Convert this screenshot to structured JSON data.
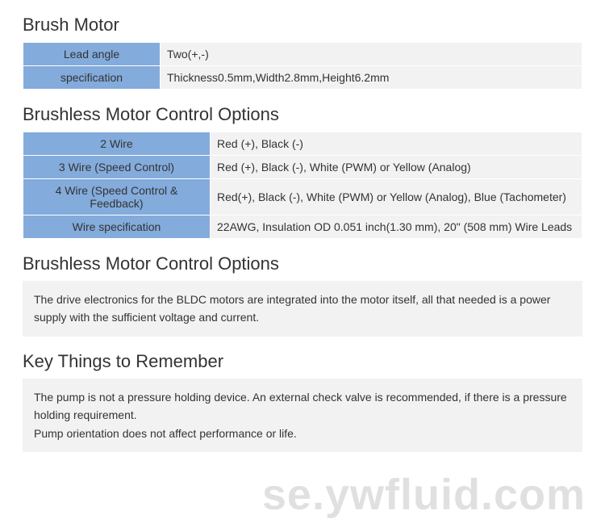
{
  "section1": {
    "title": "Brush Motor",
    "rows": [
      {
        "label": "Lead angle",
        "value": "Two(+,-)"
      },
      {
        "label": "specification",
        "value": "Thickness0.5mm,Width2.8mm,Height6.2mm"
      }
    ]
  },
  "section2": {
    "title": "Brushless Motor Control Options",
    "rows": [
      {
        "label": "2 Wire",
        "value": "Red (+), Black (-)"
      },
      {
        "label": "3 Wire (Speed Control)",
        "value": "Red (+), Black (-), White (PWM) or Yellow (Analog)"
      },
      {
        "label": "4 Wire (Speed Control & Feedback)",
        "value": "Red(+), Black (-), White (PWM) or Yellow (Analog), Blue (Tachometer)"
      },
      {
        "label": "Wire specification",
        "value": "22AWG, Insulation OD 0.051 inch(1.30 mm), 20\" (508 mm) Wire Leads"
      }
    ]
  },
  "section3": {
    "title": "Brushless Motor Control Options",
    "text": "The drive electronics for the BLDC motors are integrated into the motor itself, all that needed is a power supply with the sufficient voltage and current."
  },
  "section4": {
    "title": "Key Things to Remember",
    "text1": "The pump is not a pressure holding device. An external check valve is recommended, if there is a pressure holding requirement.",
    "text2": "Pump orientation does not affect performance or life."
  },
  "watermark": "se.ywfluid.com"
}
